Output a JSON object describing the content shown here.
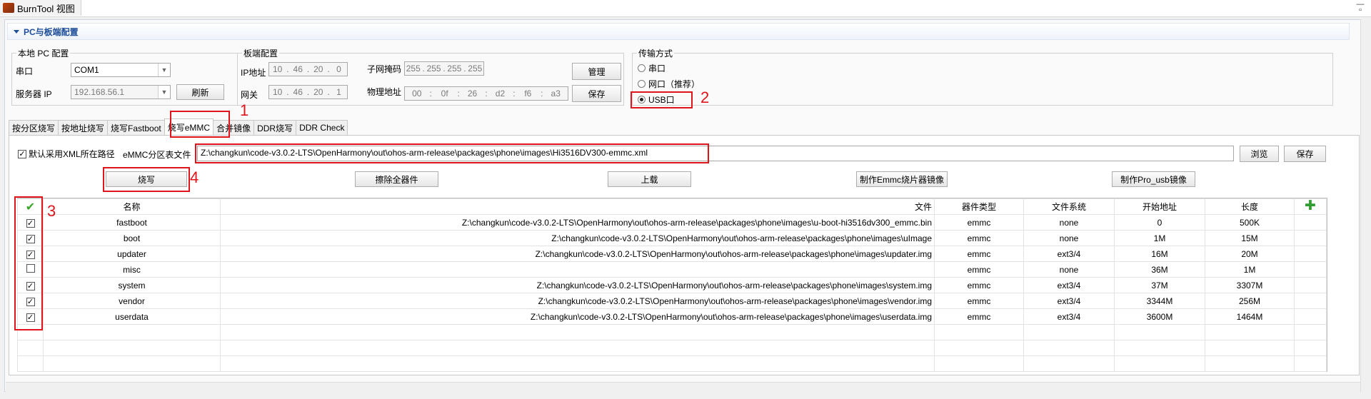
{
  "app": {
    "tab_title": "BurnTool 视图"
  },
  "section": {
    "title": "PC与板端配置"
  },
  "pc_config": {
    "legend": "本地 PC 配置",
    "port_label": "串口",
    "port_value": "COM1",
    "server_ip_label": "服务器 IP",
    "server_ip_value": "192.168.56.1",
    "refresh_button": "刷新"
  },
  "board_config": {
    "legend": "板端配置",
    "ip_label": "IP地址",
    "ip": [
      "10",
      "46",
      "20",
      "0"
    ],
    "gateway_label": "网关",
    "gateway": [
      "10",
      "46",
      "20",
      "1"
    ],
    "mask_label": "子网掩码",
    "mask": [
      "255",
      "255",
      "255",
      "255"
    ],
    "mac_label": "物理地址",
    "mac": [
      "00",
      "0f",
      "26",
      "d2",
      "f6",
      "a3"
    ],
    "manage_button": "管理",
    "save_button": "保存"
  },
  "transfer": {
    "legend": "传输方式",
    "options": [
      {
        "label": "串口",
        "selected": false
      },
      {
        "label": "网口（推荐）",
        "selected": false
      },
      {
        "label": "USB口",
        "selected": true
      }
    ]
  },
  "tabs": [
    {
      "label": "按分区烧写"
    },
    {
      "label": "按地址烧写"
    },
    {
      "label": "烧写Fastboot"
    },
    {
      "label": "烧写eMMC",
      "active": true
    },
    {
      "label": "合并镜像"
    },
    {
      "label": "DDR烧写"
    },
    {
      "label": "DDR Check"
    }
  ],
  "xml_row": {
    "default_xml_label": "默认采用XML所在路径",
    "emmc_table_label": "eMMC分区表文件",
    "path": "Z:\\changkun\\code-v3.0.2-LTS\\OpenHarmony\\out\\ohos-arm-release\\packages\\phone\\images\\Hi3516DV300-emmc.xml",
    "browse_button": "浏览",
    "save_button": "保存"
  },
  "actions": {
    "burn": "烧写",
    "erase_all": "擦除全器件",
    "upload": "上载",
    "make_emmc_image": "制作Emmc烧片器镜像",
    "make_pro_usb": "制作Pro_usb镜像"
  },
  "table": {
    "columns": [
      "名称",
      "文件",
      "器件类型",
      "文件系统",
      "开始地址",
      "长度"
    ],
    "rows": [
      {
        "checked": true,
        "name": "fastboot",
        "file": "Z:\\changkun\\code-v3.0.2-LTS\\OpenHarmony\\out\\ohos-arm-release\\packages\\phone\\images\\u-boot-hi3516dv300_emmc.bin",
        "device": "emmc",
        "fs": "none",
        "start": "0",
        "length": "500K"
      },
      {
        "checked": true,
        "name": "boot",
        "file": "Z:\\changkun\\code-v3.0.2-LTS\\OpenHarmony\\out\\ohos-arm-release\\packages\\phone\\images\\uImage",
        "device": "emmc",
        "fs": "none",
        "start": "1M",
        "length": "15M"
      },
      {
        "checked": true,
        "name": "updater",
        "file": "Z:\\changkun\\code-v3.0.2-LTS\\OpenHarmony\\out\\ohos-arm-release\\packages\\phone\\images\\updater.img",
        "device": "emmc",
        "fs": "ext3/4",
        "start": "16M",
        "length": "20M"
      },
      {
        "checked": false,
        "name": "misc",
        "file": "",
        "device": "emmc",
        "fs": "none",
        "start": "36M",
        "length": "1M"
      },
      {
        "checked": true,
        "name": "system",
        "file": "Z:\\changkun\\code-v3.0.2-LTS\\OpenHarmony\\out\\ohos-arm-release\\packages\\phone\\images\\system.img",
        "device": "emmc",
        "fs": "ext3/4",
        "start": "37M",
        "length": "3307M"
      },
      {
        "checked": true,
        "name": "vendor",
        "file": "Z:\\changkun\\code-v3.0.2-LTS\\OpenHarmony\\out\\ohos-arm-release\\packages\\phone\\images\\vendor.img",
        "device": "emmc",
        "fs": "ext3/4",
        "start": "3344M",
        "length": "256M"
      },
      {
        "checked": true,
        "name": "userdata",
        "file": "Z:\\changkun\\code-v3.0.2-LTS\\OpenHarmony\\out\\ohos-arm-release\\packages\\phone\\images\\userdata.img",
        "device": "emmc",
        "fs": "ext3/4",
        "start": "3600M",
        "length": "1464M"
      }
    ]
  },
  "annotations": [
    "1",
    "2",
    "3",
    "4"
  ],
  "colors": {
    "annotation_red": "#e0151b",
    "header_blue": "#1f4e99",
    "check_green": "#3aa52b",
    "add_green": "#2e9e2e"
  }
}
